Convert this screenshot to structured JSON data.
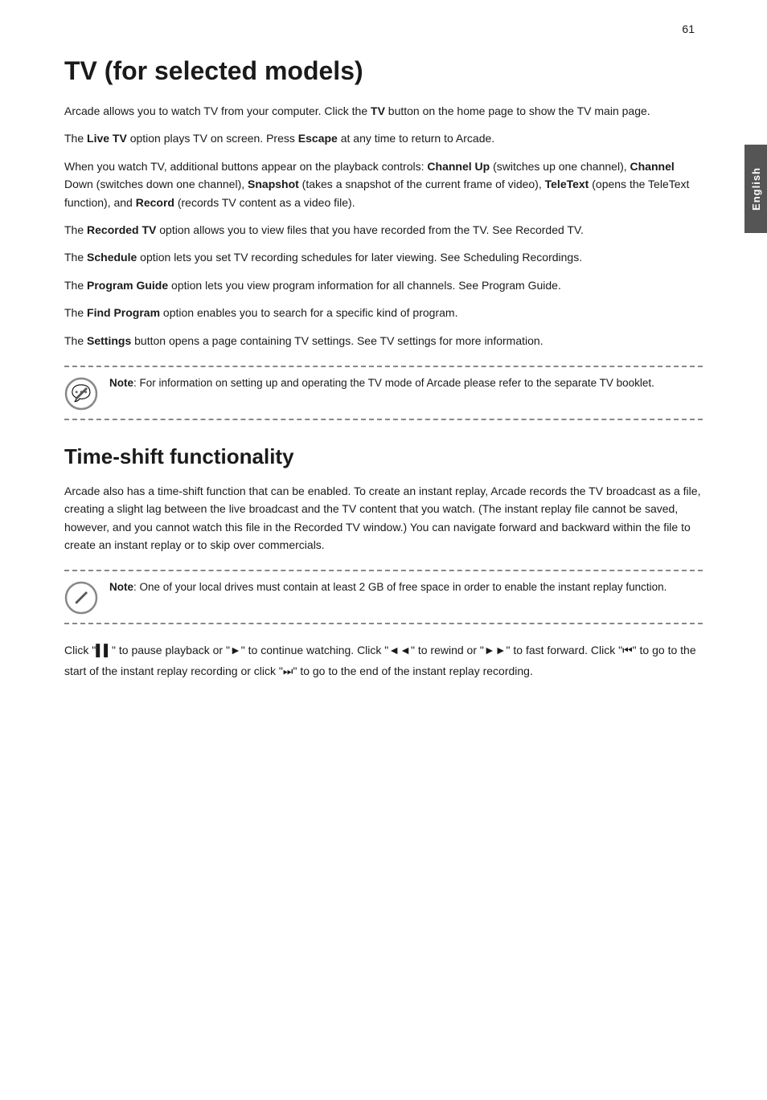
{
  "page": {
    "number": "61",
    "sidebar_label": "English"
  },
  "section1": {
    "title": "TV (for selected models)",
    "paragraphs": [
      {
        "id": "p1",
        "text": "Arcade allows you to watch TV from your computer. Click the ",
        "bold_parts": [
          {
            "text": "TV",
            "after": " button on the home page to show the TV main page."
          }
        ]
      },
      {
        "id": "p2",
        "text": "The ",
        "inline_bold": "Live TV",
        "rest": " option plays TV on screen. Press ",
        "inline_bold2": "Escape",
        "rest2": " at any time to return to Arcade."
      },
      {
        "id": "p3",
        "text": "When you watch TV, additional buttons appear on the playback controls: Channel Up (switches up one channel), Channel Down (switches down one channel), Snapshot (takes a snapshot of the current frame of video), TeleText (opens the TeleText function), and Record (records TV content as a video file)."
      },
      {
        "id": "p4",
        "text": "The ",
        "inline_bold": "Recorded TV",
        "rest": " option allows you to view files that you have recorded from the TV. See Recorded TV."
      },
      {
        "id": "p5",
        "text": "The ",
        "inline_bold": "Schedule",
        "rest": " option lets you set TV recording schedules for later viewing. See Scheduling Recordings."
      },
      {
        "id": "p6",
        "text": "The ",
        "inline_bold": "Program Guide",
        "rest": " option lets you view program information for all channels. See Program Guide."
      },
      {
        "id": "p7",
        "text": "The ",
        "inline_bold": "Find Program",
        "rest": " option enables you to search for a specific kind of program."
      },
      {
        "id": "p8",
        "text": "The ",
        "inline_bold": "Settings",
        "rest": " button opens a page containing TV settings. See TV settings for more information."
      }
    ],
    "note": {
      "label": "Note",
      "text": ": For information on setting up and operating the TV mode of Arcade please refer to the separate TV booklet."
    }
  },
  "section2": {
    "title": "Time-shift functionality",
    "paragraph": "Arcade also has a time-shift function that can be enabled. To create an instant replay, Arcade records the TV broadcast as a file, creating a slight lag between the live broadcast and the TV content that you watch. (The instant replay file cannot be saved, however, and you cannot watch this file in the Recorded TV window.) You can navigate forward and backward within the file to create an instant replay or to skip over commercials.",
    "note": {
      "label": "Note",
      "text": ": One of your local drives must contain at least 2 GB of free space in order to enable the instant replay function."
    },
    "bottom_text_lines": [
      {
        "line": "Click \"▌▌\" to pause playback or \"►\" to continue watching. Click \"◄◄\" to"
      },
      {
        "line": "rewind or \"►►\" to fast forward. Click \"⏮\" to go to the start of the instant"
      },
      {
        "line": "replay recording or click \"⏭\" to go to the end of the instant replay recording."
      }
    ]
  }
}
